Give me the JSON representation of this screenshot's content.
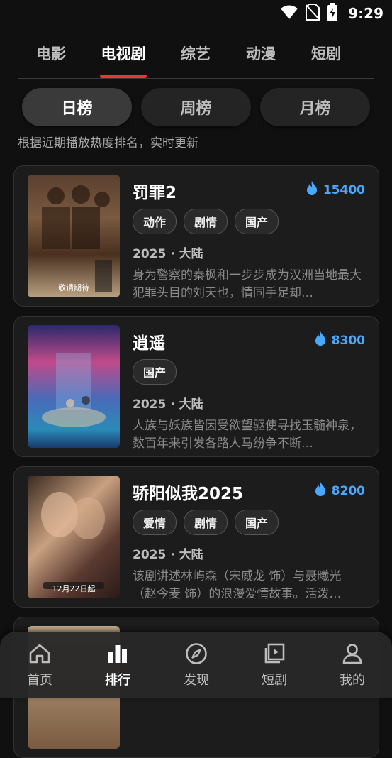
{
  "status_bar": {
    "time": "9:29",
    "icons": [
      "wifi-icon",
      "no-sim-icon",
      "battery-charging-icon"
    ]
  },
  "category_tabs": [
    {
      "label": "电影",
      "active": false
    },
    {
      "label": "电视剧",
      "active": true
    },
    {
      "label": "综艺",
      "active": false
    },
    {
      "label": "动漫",
      "active": false
    },
    {
      "label": "短剧",
      "active": false
    }
  ],
  "rank_tabs": [
    {
      "label": "日榜",
      "active": true
    },
    {
      "label": "周榜",
      "active": false
    },
    {
      "label": "月榜",
      "active": false
    }
  ],
  "subtitle": "根据近期播放热度排名，实时更新",
  "shows": [
    {
      "title": "罚罪2",
      "heat": "15400",
      "tags": [
        "动作",
        "剧情",
        "国产"
      ],
      "meta": "2025 · 大陆",
      "description": "身为警察的秦枫和一步步成为汉洲当地最大犯罪头目的刘天也，情同手足却…",
      "poster_caption": "敬请期待"
    },
    {
      "title": "逍遥",
      "heat": "8300",
      "tags": [
        "国产"
      ],
      "meta": "2025 · 大陆",
      "description": "人族与妖族皆因受欲望驱使寻找玉髓神泉，数百年来引发各路人马纷争不断…",
      "poster_caption": ""
    },
    {
      "title": "骄阳似我2025",
      "heat": "8200",
      "tags": [
        "爱情",
        "剧情",
        "国产"
      ],
      "meta": "2025 · 大陆",
      "description": "该剧讲述林屿森（宋威龙 饰）与聂曦光（赵今麦 饰）的浪漫爱情故事。活泼…",
      "poster_caption": "12月22日起"
    },
    {
      "title": "",
      "heat": "",
      "tags": [],
      "meta": "",
      "description": "",
      "poster_caption": ""
    }
  ],
  "bottom_nav": [
    {
      "label": "首页",
      "icon": "home-icon",
      "active": false
    },
    {
      "label": "排行",
      "icon": "ranking-icon",
      "active": true
    },
    {
      "label": "发现",
      "icon": "compass-icon",
      "active": false
    },
    {
      "label": "短剧",
      "icon": "video-icon",
      "active": false
    },
    {
      "label": "我的",
      "icon": "profile-icon",
      "active": false
    }
  ],
  "colors": {
    "accent": "#e53935",
    "heat": "#4aa8ff",
    "background": "#101010",
    "card": "#1c1c1c"
  }
}
